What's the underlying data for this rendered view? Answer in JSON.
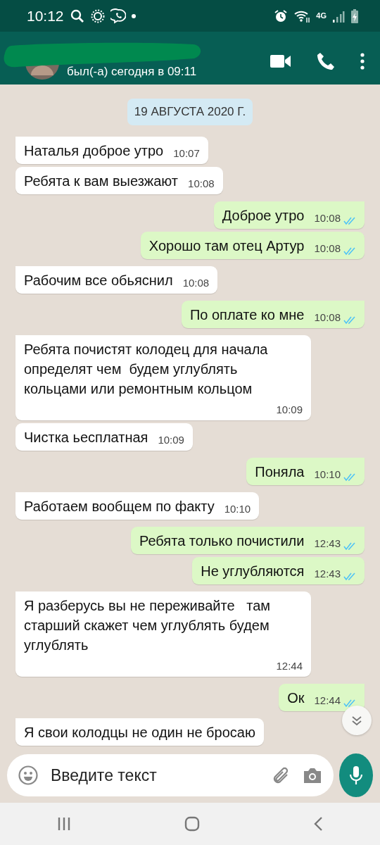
{
  "status_bar": {
    "time": "10:12",
    "network": "4G"
  },
  "header": {
    "last_seen": "был(-а) сегодня в 09:11"
  },
  "date_chip": "19 АВГУСТА 2020 Г.",
  "messages": [
    {
      "kind": "in",
      "text": "Наталья доброе утро",
      "time": "10:07",
      "tail": true
    },
    {
      "kind": "in",
      "text": "Ребята к вам выезжают",
      "time": "10:08",
      "tail": false
    },
    {
      "kind": "out",
      "text": "Доброе утро",
      "time": "10:08",
      "tail": true,
      "read": true
    },
    {
      "kind": "out",
      "text": "Хорошо там отец Артур",
      "time": "10:08",
      "tail": false,
      "read": true
    },
    {
      "kind": "in",
      "text": "Рабочим все обьяснил",
      "time": "10:08",
      "tail": true
    },
    {
      "kind": "out",
      "text": "По оплате ко мне",
      "time": "10:08",
      "tail": true,
      "read": true
    },
    {
      "kind": "in",
      "text": "Ребята почистят колодец для начала определят чем  будем углублять кольцами или ремонтным кольцом",
      "time": "10:09",
      "tail": true
    },
    {
      "kind": "in",
      "text": "Чистка ьесплатная",
      "time": "10:09",
      "tail": false
    },
    {
      "kind": "out",
      "text": "Поняла",
      "time": "10:10",
      "tail": true,
      "read": true
    },
    {
      "kind": "in",
      "text": "Работаем вообщем по факту",
      "time": "10:10",
      "tail": true
    },
    {
      "kind": "out",
      "text": "Ребята только почистили",
      "time": "12:43",
      "tail": true,
      "read": true
    },
    {
      "kind": "out",
      "text": "Не углубляются",
      "time": "12:43",
      "tail": false,
      "read": true
    },
    {
      "kind": "in",
      "text": "Я разберусь вы не переживайте   там старший скажет чем углублять будем углублять",
      "time": "12:44",
      "tail": true
    },
    {
      "kind": "out",
      "text": "Ок",
      "time": "12:44",
      "tail": true,
      "read": true
    },
    {
      "kind": "in",
      "text": "Я свои колодцы не один не бросаю",
      "tail": true
    }
  ],
  "composer": {
    "placeholder": "Введите текст"
  }
}
